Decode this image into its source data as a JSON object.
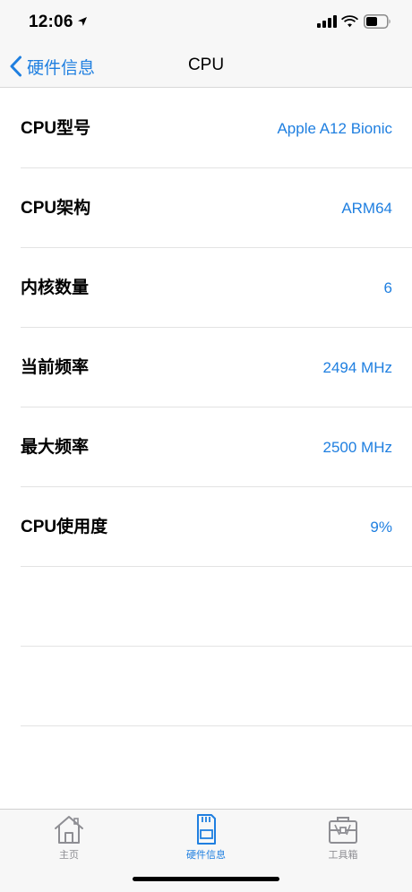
{
  "status_bar": {
    "time": "12:06",
    "icons": [
      "location-arrow-icon",
      "cellular-signal-icon",
      "wifi-icon",
      "battery-icon"
    ]
  },
  "nav": {
    "back_label": "硬件信息",
    "title": "CPU"
  },
  "rows": [
    {
      "label": "CPU型号",
      "value": "Apple A12 Bionic"
    },
    {
      "label": "CPU架构",
      "value": "ARM64"
    },
    {
      "label": "内核数量",
      "value": "6"
    },
    {
      "label": "当前频率",
      "value": "2494 MHz"
    },
    {
      "label": "最大频率",
      "value": "2500 MHz"
    },
    {
      "label": "CPU使用度",
      "value": "9%"
    }
  ],
  "tabs": [
    {
      "label": "主页",
      "icon": "house-icon",
      "active": false
    },
    {
      "label": "硬件信息",
      "icon": "sd-card-icon",
      "active": true
    },
    {
      "label": "工具箱",
      "icon": "toolbox-icon",
      "active": false
    }
  ],
  "colors": {
    "accent": "#1f7fe0",
    "inactive": "#8e8e93",
    "bar_background": "#f7f7f7"
  }
}
